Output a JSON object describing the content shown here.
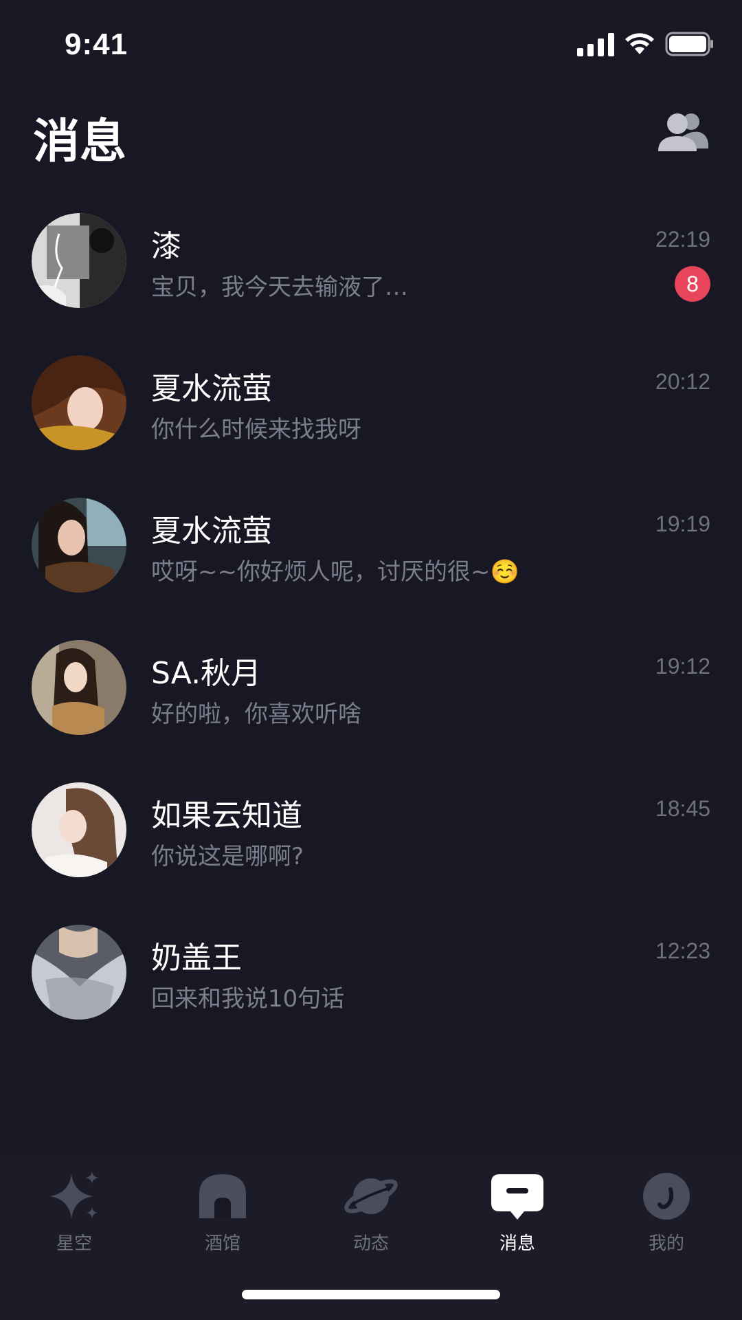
{
  "status_bar": {
    "time": "9:41"
  },
  "header": {
    "title": "消息",
    "contacts_icon": "contacts-icon"
  },
  "messages": [
    {
      "name": "漆",
      "preview": "宝贝，我今天去输液了…",
      "time": "22:19",
      "unread": "8"
    },
    {
      "name": "夏水流萤",
      "preview": "你什么时候来找我呀",
      "time": "20:12"
    },
    {
      "name": "夏水流萤",
      "preview": "哎呀~~你好烦人呢，讨厌的很~☺️",
      "time": "19:19"
    },
    {
      "name": "SA.秋月",
      "preview": "好的啦，你喜欢听啥",
      "time": "19:12"
    },
    {
      "name": "如果云知道",
      "preview": "你说这是哪啊?",
      "time": "18:45"
    },
    {
      "name": "奶盖王",
      "preview": "回来和我说10句话",
      "time": "12:23"
    }
  ],
  "tabs": [
    {
      "label": "星空",
      "icon": "sparkle-icon",
      "active": false
    },
    {
      "label": "酒馆",
      "icon": "tavern-icon",
      "active": false
    },
    {
      "label": "动态",
      "icon": "planet-icon",
      "active": false
    },
    {
      "label": "消息",
      "icon": "chat-bubble-icon",
      "active": true
    },
    {
      "label": "我的",
      "icon": "profile-icon",
      "active": false
    }
  ],
  "colors": {
    "background": "#171824",
    "tab_bar": "#1b1c28",
    "badge": "#e8445a",
    "muted_text": "#7c7e8c"
  }
}
